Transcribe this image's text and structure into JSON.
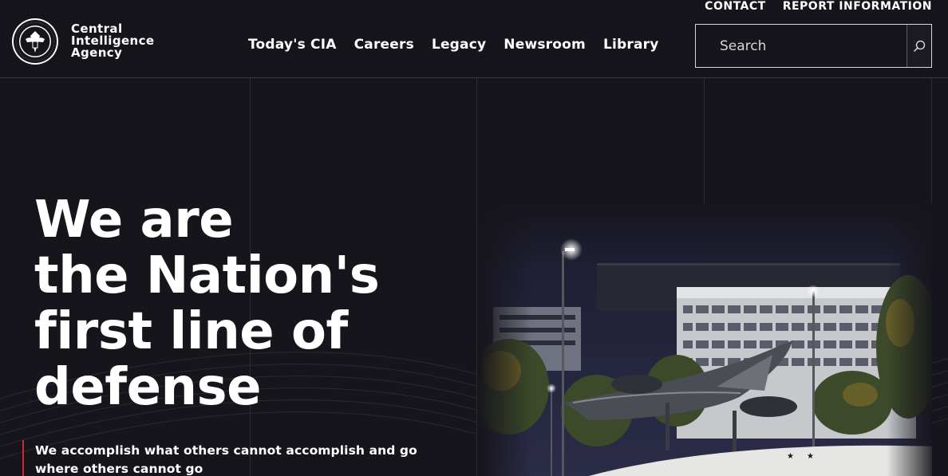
{
  "brand": {
    "line1": "Central",
    "line2": "Intelligence",
    "line3": "Agency",
    "seal_icon": "cia-seal-icon"
  },
  "utility_nav": [
    {
      "label": "CONTACT"
    },
    {
      "label": "REPORT INFORMATION"
    }
  ],
  "main_nav": [
    {
      "label": "Today's CIA"
    },
    {
      "label": "Careers"
    },
    {
      "label": "Legacy"
    },
    {
      "label": "Newsroom"
    },
    {
      "label": "Library"
    }
  ],
  "search": {
    "placeholder": "Search",
    "value": "",
    "icon": "search-icon"
  },
  "hero": {
    "title_lines": [
      "We are",
      "the Nation's",
      "first line of",
      "defense"
    ],
    "tagline": "We accomplish what others cannot accomplish and go where others cannot go"
  },
  "colors": {
    "background": "#16151b",
    "accent": "#d0283a",
    "text": "#ffffff"
  }
}
